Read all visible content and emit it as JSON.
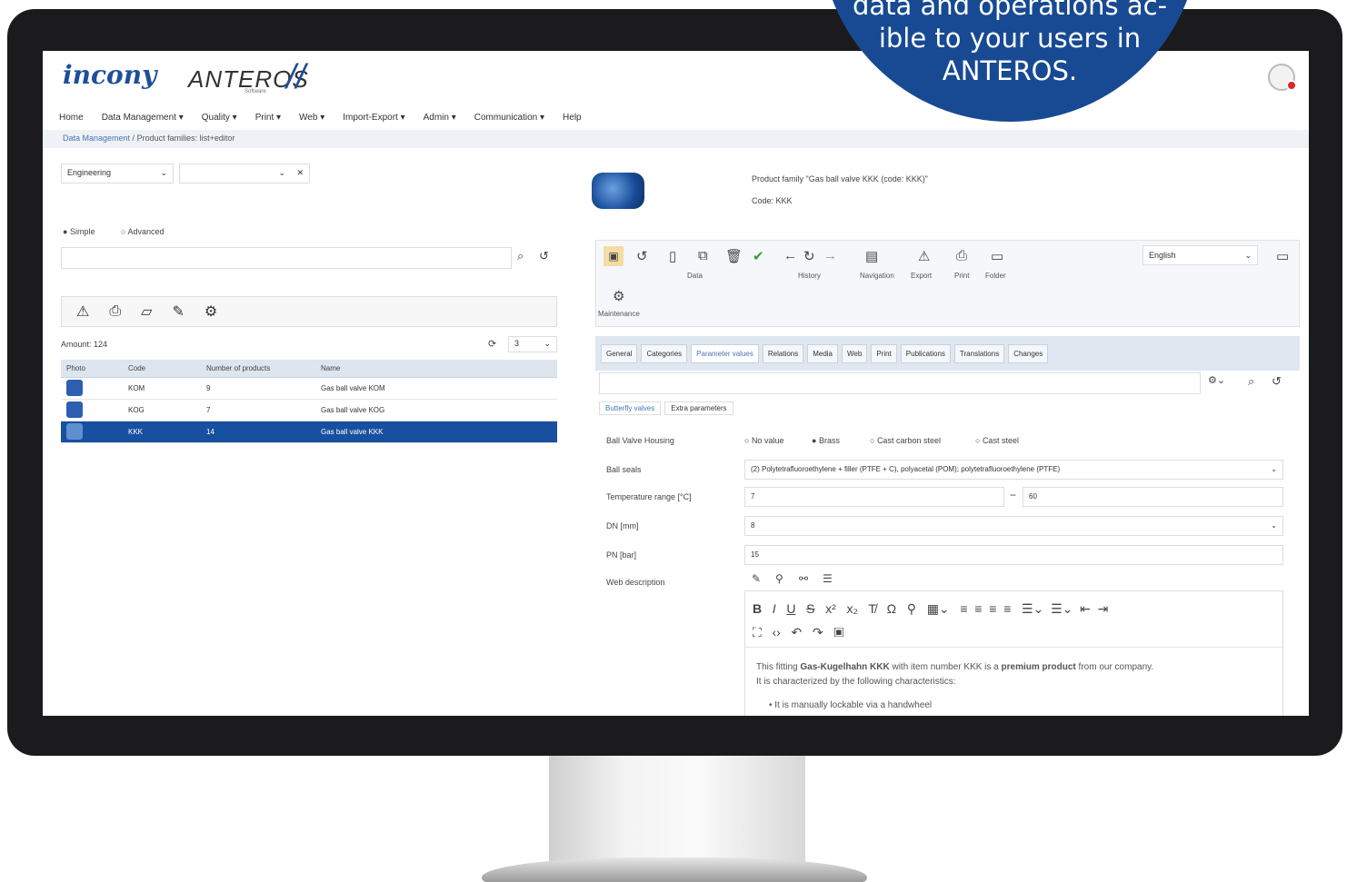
{
  "callout": {
    "line1": "data and operations ac-",
    "line2": "ible to your users in",
    "line3": "ANTEROS."
  },
  "header": {
    "logo": "incony",
    "brand": "ANTEROS",
    "brand_sub": "Software"
  },
  "menu": [
    "Home",
    "Data Management ▾",
    "Quality ▾",
    "Print ▾",
    "Web ▾",
    "Import-Export ▾",
    "Admin ▾",
    "Communication ▾",
    "Help"
  ],
  "breadcrumb": {
    "root": "Data Management",
    "sep": " / ",
    "current": "Product families: list+editor"
  },
  "left": {
    "category": "Engineering",
    "subcategory": "",
    "mode_simple": "Simple",
    "mode_advanced": "Advanced",
    "amount": "Amount: 124",
    "page_size": "3",
    "columns": [
      "Photo",
      "Code",
      "Number of products",
      "Name"
    ],
    "rows": [
      {
        "code": "KOM",
        "count": "9",
        "name": "Gas ball valve KOM"
      },
      {
        "code": "KOG",
        "count": "7",
        "name": "Gas ball valve KOG"
      },
      {
        "code": "KKK",
        "count": "14",
        "name": "Gas ball valve KKK"
      }
    ]
  },
  "right": {
    "title": "Product family \"Gas ball valve KKK (code: KKK)\"",
    "code": "Code: KKK",
    "toolbar": {
      "data": "Data",
      "history": "History",
      "navigation": "Navigation",
      "export": "Export",
      "print": "Print",
      "folder": "Folder",
      "maintenance": "Maintenance"
    },
    "language": "English",
    "tabs": [
      "General",
      "Categories",
      "Parameter values",
      "Relations",
      "Media",
      "Web",
      "Print",
      "Publications",
      "Translations",
      "Changes"
    ],
    "subtabs": [
      "Butterfly valves",
      "Extra parameters"
    ],
    "fields": {
      "housing_label": "Ball Valve Housing",
      "housing_options": [
        "No value",
        "Brass",
        "Cast carbon steel",
        "Cast steel"
      ],
      "seals_label": "Ball seals",
      "seals_value": "(2) Polytetrafluoroethylene + filler (PTFE + C), polyacetal (POM); polytetrafluoroethylene (PTFE)",
      "temp_label": "Temperature range [°C]",
      "temp_min": "7",
      "temp_max": "60",
      "dn_label": "DN [mm]",
      "dn_value": "8",
      "pn_label": "PN [bar]",
      "pn_value": "15",
      "web_label": "Web description"
    },
    "editor": {
      "p1a": "This fitting ",
      "p1b": "Gas-Kugelhahn KKK",
      "p1c": " with item number KKK is a ",
      "p1d": "premium product",
      "p1e": " from our company.",
      "p2": "It is characterized by the following characteristics:",
      "li1": "It is manually lockable via a handwheel"
    }
  }
}
